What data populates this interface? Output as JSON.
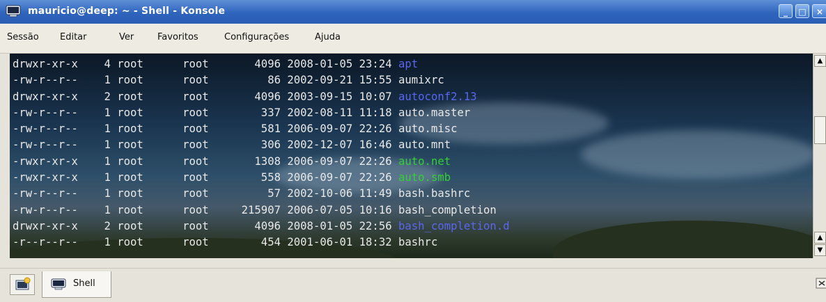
{
  "window": {
    "title": "mauricio@deep: ~ - Shell - Konsole",
    "icon": "terminal-icon",
    "controls": [
      "minimize",
      "maximize",
      "close"
    ]
  },
  "menu": [
    "Sessão",
    "Editar",
    "Ver",
    "Favoritos",
    "Configurações",
    "Ajuda"
  ],
  "colors": {
    "directory": "#5a66f0",
    "executable": "#34d034",
    "text": "#e8e8e8",
    "titlebar": "#2f64bd"
  },
  "terminal": {
    "rows": [
      {
        "perms": "drwxr-xr-x",
        "links": "4",
        "owner": "root",
        "group": "root",
        "size": "4096",
        "date": "2008-01-05",
        "time": "23:24",
        "name": "apt",
        "kind": "dir"
      },
      {
        "perms": "-rw-r--r--",
        "links": "1",
        "owner": "root",
        "group": "root",
        "size": "86",
        "date": "2002-09-21",
        "time": "15:55",
        "name": "aumixrc",
        "kind": "file"
      },
      {
        "perms": "drwxr-xr-x",
        "links": "2",
        "owner": "root",
        "group": "root",
        "size": "4096",
        "date": "2003-09-15",
        "time": "10:07",
        "name": "autoconf2.13",
        "kind": "dir"
      },
      {
        "perms": "-rw-r--r--",
        "links": "1",
        "owner": "root",
        "group": "root",
        "size": "337",
        "date": "2002-08-11",
        "time": "11:18",
        "name": "auto.master",
        "kind": "file"
      },
      {
        "perms": "-rw-r--r--",
        "links": "1",
        "owner": "root",
        "group": "root",
        "size": "581",
        "date": "2006-09-07",
        "time": "22:26",
        "name": "auto.misc",
        "kind": "file"
      },
      {
        "perms": "-rw-r--r--",
        "links": "1",
        "owner": "root",
        "group": "root",
        "size": "306",
        "date": "2002-12-07",
        "time": "16:46",
        "name": "auto.mnt",
        "kind": "file"
      },
      {
        "perms": "-rwxr-xr-x",
        "links": "1",
        "owner": "root",
        "group": "root",
        "size": "1308",
        "date": "2006-09-07",
        "time": "22:26",
        "name": "auto.net",
        "kind": "exec"
      },
      {
        "perms": "-rwxr-xr-x",
        "links": "1",
        "owner": "root",
        "group": "root",
        "size": "558",
        "date": "2006-09-07",
        "time": "22:26",
        "name": "auto.smb",
        "kind": "exec"
      },
      {
        "perms": "-rw-r--r--",
        "links": "1",
        "owner": "root",
        "group": "root",
        "size": "57",
        "date": "2002-10-06",
        "time": "11:49",
        "name": "bash.bashrc",
        "kind": "file"
      },
      {
        "perms": "-rw-r--r--",
        "links": "1",
        "owner": "root",
        "group": "root",
        "size": "215907",
        "date": "2006-07-05",
        "time": "10:16",
        "name": "bash_completion",
        "kind": "file"
      },
      {
        "perms": "drwxr-xr-x",
        "links": "2",
        "owner": "root",
        "group": "root",
        "size": "4096",
        "date": "2008-01-05",
        "time": "22:56",
        "name": "bash_completion.d",
        "kind": "dir"
      },
      {
        "perms": "-r--r--r--",
        "links": "1",
        "owner": "root",
        "group": "root",
        "size": "454",
        "date": "2001-06-01",
        "time": "18:32",
        "name": "bashrc",
        "kind": "file"
      }
    ]
  },
  "tabs": [
    {
      "label": "Shell",
      "icon": "terminal-icon"
    }
  ],
  "icons": {
    "new_tab": "new-session-icon",
    "close_tab": "close-session-icon"
  }
}
